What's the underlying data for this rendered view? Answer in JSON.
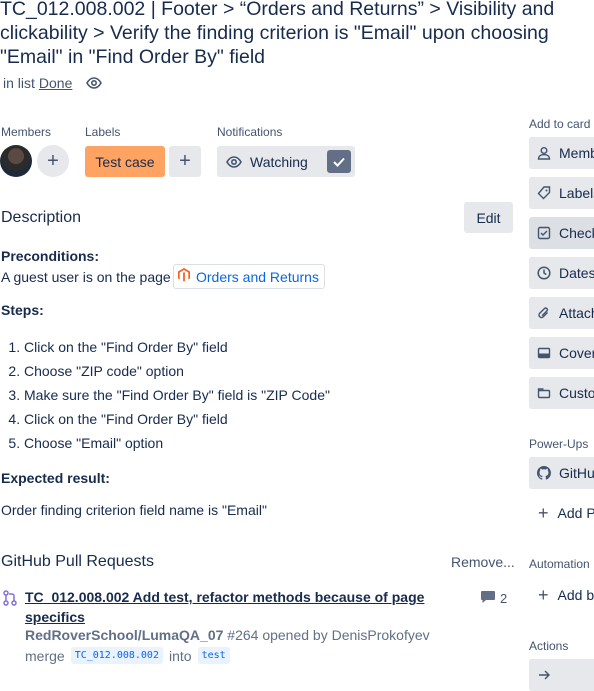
{
  "card": {
    "title": "TC_012.008.002 | Footer > “Orders and Returns” > Visibility and clickability > Verify the finding criterion is \"Email\" upon choosing \"Email\" in \"Find Order By\" field",
    "list_prefix": "in list",
    "list_name": "Done"
  },
  "members": {
    "heading": "Members",
    "avatar_icon": "user-avatar"
  },
  "labels": {
    "heading": "Labels",
    "items": [
      "Test case"
    ],
    "color": "#fea362"
  },
  "notifications": {
    "heading": "Notifications",
    "watch_label": "Watching",
    "watching": true
  },
  "description": {
    "heading": "Description",
    "edit_label": "Edit",
    "preconditions_heading": "Preconditions:",
    "preconditions_text": "A guest user is on the page",
    "preconditions_link": "Orders and Returns",
    "steps_heading": "Steps:",
    "steps": [
      "Click on the \"Find Order By\" field",
      "Choose \"ZIP code\" option",
      "Make sure the \"Find Order By\" field is \"ZIP Code\"",
      "Click on the \"Find Order By\" field",
      "Choose \"Email\" option"
    ],
    "expected_heading": "Expected result:",
    "expected_text": "Order finding criterion field name is \"Email\""
  },
  "github": {
    "heading": "GitHub Pull Requests",
    "remove_label": "Remove...",
    "pr": {
      "title": "TC_012.008.002 Add test, refactor methods because of page specifics",
      "comment_count": "2",
      "repo": "RedRoverSchool/LumaQA_07",
      "meta": "#264 opened by DenisProkofyev",
      "merge_word": "merge",
      "source_branch": "TC_012.008.002",
      "into_word": "into",
      "target_branch": "test"
    }
  },
  "sidebar": {
    "add_to_card_heading": "Add to card",
    "add_to_card": [
      {
        "label": "Members",
        "icon": "person-icon"
      },
      {
        "label": "Labels",
        "icon": "tag-icon"
      },
      {
        "label": "Checklist",
        "icon": "checkbox-icon"
      },
      {
        "label": "Dates",
        "icon": "clock-icon"
      },
      {
        "label": "Attachment",
        "icon": "paperclip-icon"
      },
      {
        "label": "Cover",
        "icon": "cover-icon"
      },
      {
        "label": "Custom Fields",
        "icon": "custom-fields-icon"
      }
    ],
    "powerups_heading": "Power-Ups",
    "github_label": "GitHub",
    "add_powerup_label": "Add Power-Ups",
    "automation_heading": "Automation",
    "add_button_label": "Add button",
    "actions_heading": "Actions"
  },
  "colors": {
    "text": "#172b4d",
    "muted": "#44546f",
    "button_bg": "#e6e8eb",
    "link": "#0c66e4",
    "watch_check_bg": "#626f86"
  }
}
